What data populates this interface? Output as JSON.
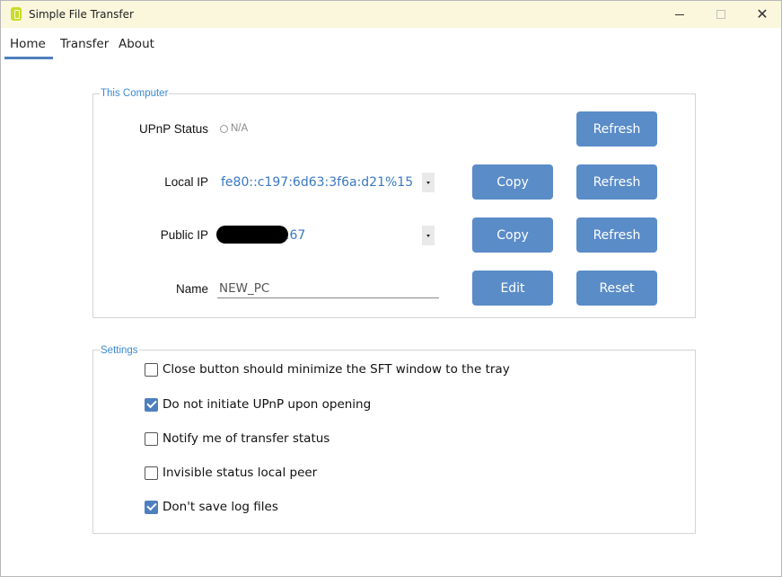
{
  "window": {
    "title": "Simple File Transfer",
    "icon": "app-logo-icon"
  },
  "controls": {
    "minimize": "minimize-icon",
    "maximize": "maximize-icon",
    "close": "✕"
  },
  "tabs": [
    {
      "label": "Home",
      "active": true
    },
    {
      "label": "Transfer",
      "active": false
    },
    {
      "label": "About",
      "active": false
    }
  ],
  "this_computer": {
    "title": "This Computer",
    "upnp": {
      "label": "UPnP Status",
      "value": "N/A",
      "refresh": "Refresh"
    },
    "local_ip": {
      "label": "Local IP",
      "value": "fe80::c197:6d63:3f6a:d21%15",
      "copy": "Copy",
      "refresh": "Refresh"
    },
    "public_ip": {
      "label": "Public IP",
      "value": ".67",
      "copy": "Copy",
      "refresh": "Refresh"
    },
    "name": {
      "label": "Name",
      "value": "NEW_PC",
      "edit": "Edit",
      "reset": "Reset"
    }
  },
  "settings": {
    "title": "Settings",
    "options": [
      {
        "label": "Close button should minimize the SFT window to the tray",
        "checked": false
      },
      {
        "label": "Do not initiate UPnP upon opening",
        "checked": true
      },
      {
        "label": "Notify me of transfer status",
        "checked": false
      },
      {
        "label": "Invisible status local peer",
        "checked": false
      },
      {
        "label": "Don't save log files",
        "checked": true
      }
    ]
  },
  "colors": {
    "accent": "#5a8cc8",
    "group_label": "#3a8ad6",
    "titlebar": "#faf7dc",
    "ip_text": "#3a78c4"
  }
}
